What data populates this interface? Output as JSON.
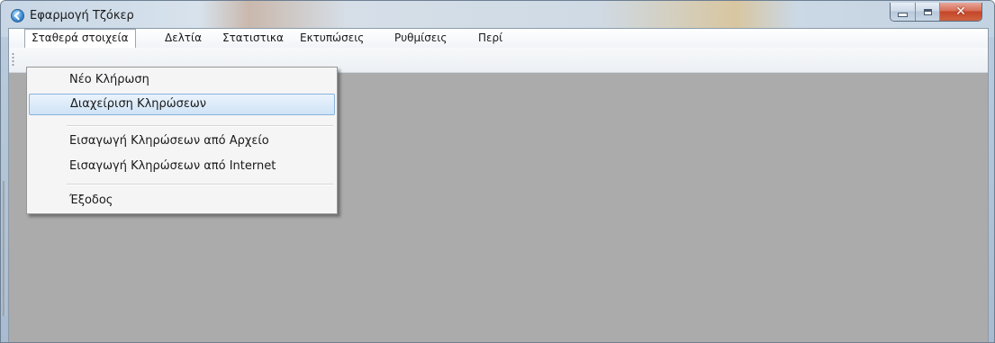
{
  "window": {
    "title": "Εφαρμογή Τζόκερ",
    "controls": {
      "minimize": "",
      "maximize": "",
      "close": "✕"
    }
  },
  "menubar": {
    "items": [
      {
        "label": "Σταθερά στοιχεία"
      },
      {
        "label": "Δελτία"
      },
      {
        "label": "Στατιστικα"
      },
      {
        "label": "Εκτυπώσεις"
      },
      {
        "label": "Ρυθμίσεις"
      },
      {
        "label": "Περί"
      }
    ]
  },
  "dropdown": {
    "items": [
      {
        "label": "Νέο Κλήρωση"
      },
      {
        "label": "Διαχείριση Κληρώσεων"
      },
      {
        "label": "Εισαγωγή Κληρώσεων από Αρχείο"
      },
      {
        "label": "Εισαγωγή Κληρώσεων από Internet"
      },
      {
        "label": "Έξοδος"
      }
    ]
  },
  "colors": {
    "client_background": "#ababab",
    "hover_highlight": "#cfe3f6",
    "close_button": "#c4452a"
  }
}
